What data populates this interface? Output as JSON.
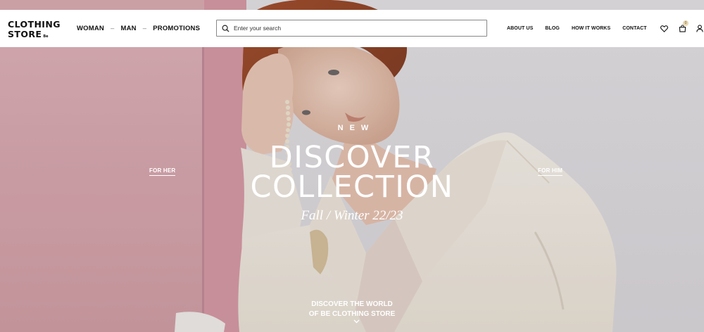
{
  "brand": {
    "line1": "CLOTHING",
    "line2": "STORE",
    "tag": "Be"
  },
  "categories": {
    "woman": "WOMAN",
    "man": "MAN",
    "promotions": "PROMOTIONS",
    "separator": "–"
  },
  "search": {
    "placeholder": "Enter your search",
    "icon": "search-icon"
  },
  "info_nav": {
    "about": "ABOUT US",
    "blog": "BLOG",
    "how": "HOW IT WORKS",
    "contact": "CONTACT"
  },
  "header_icons": {
    "wishlist": "heart-icon",
    "cart": "shopping-bag-icon",
    "cart_count": "0",
    "account": "user-icon"
  },
  "hero": {
    "kicker": "NEW",
    "title_line1": "DISCOVER",
    "title_line2": "COLLECTION",
    "subtitle": "Fall / Winter 22/23",
    "left_link": "FOR HER",
    "right_link": "FOR HIM",
    "cta_line1": "DISCOVER THE WORLD",
    "cta_line2": "OF BE CLOTHING STORE",
    "scroll_icon": "chevron-down-icon"
  },
  "colors": {
    "pink_wall": "#dcaeb4",
    "grey_wall": "#e3e1e4",
    "badge": "#e8d9b4",
    "text_dark": "#111111"
  }
}
